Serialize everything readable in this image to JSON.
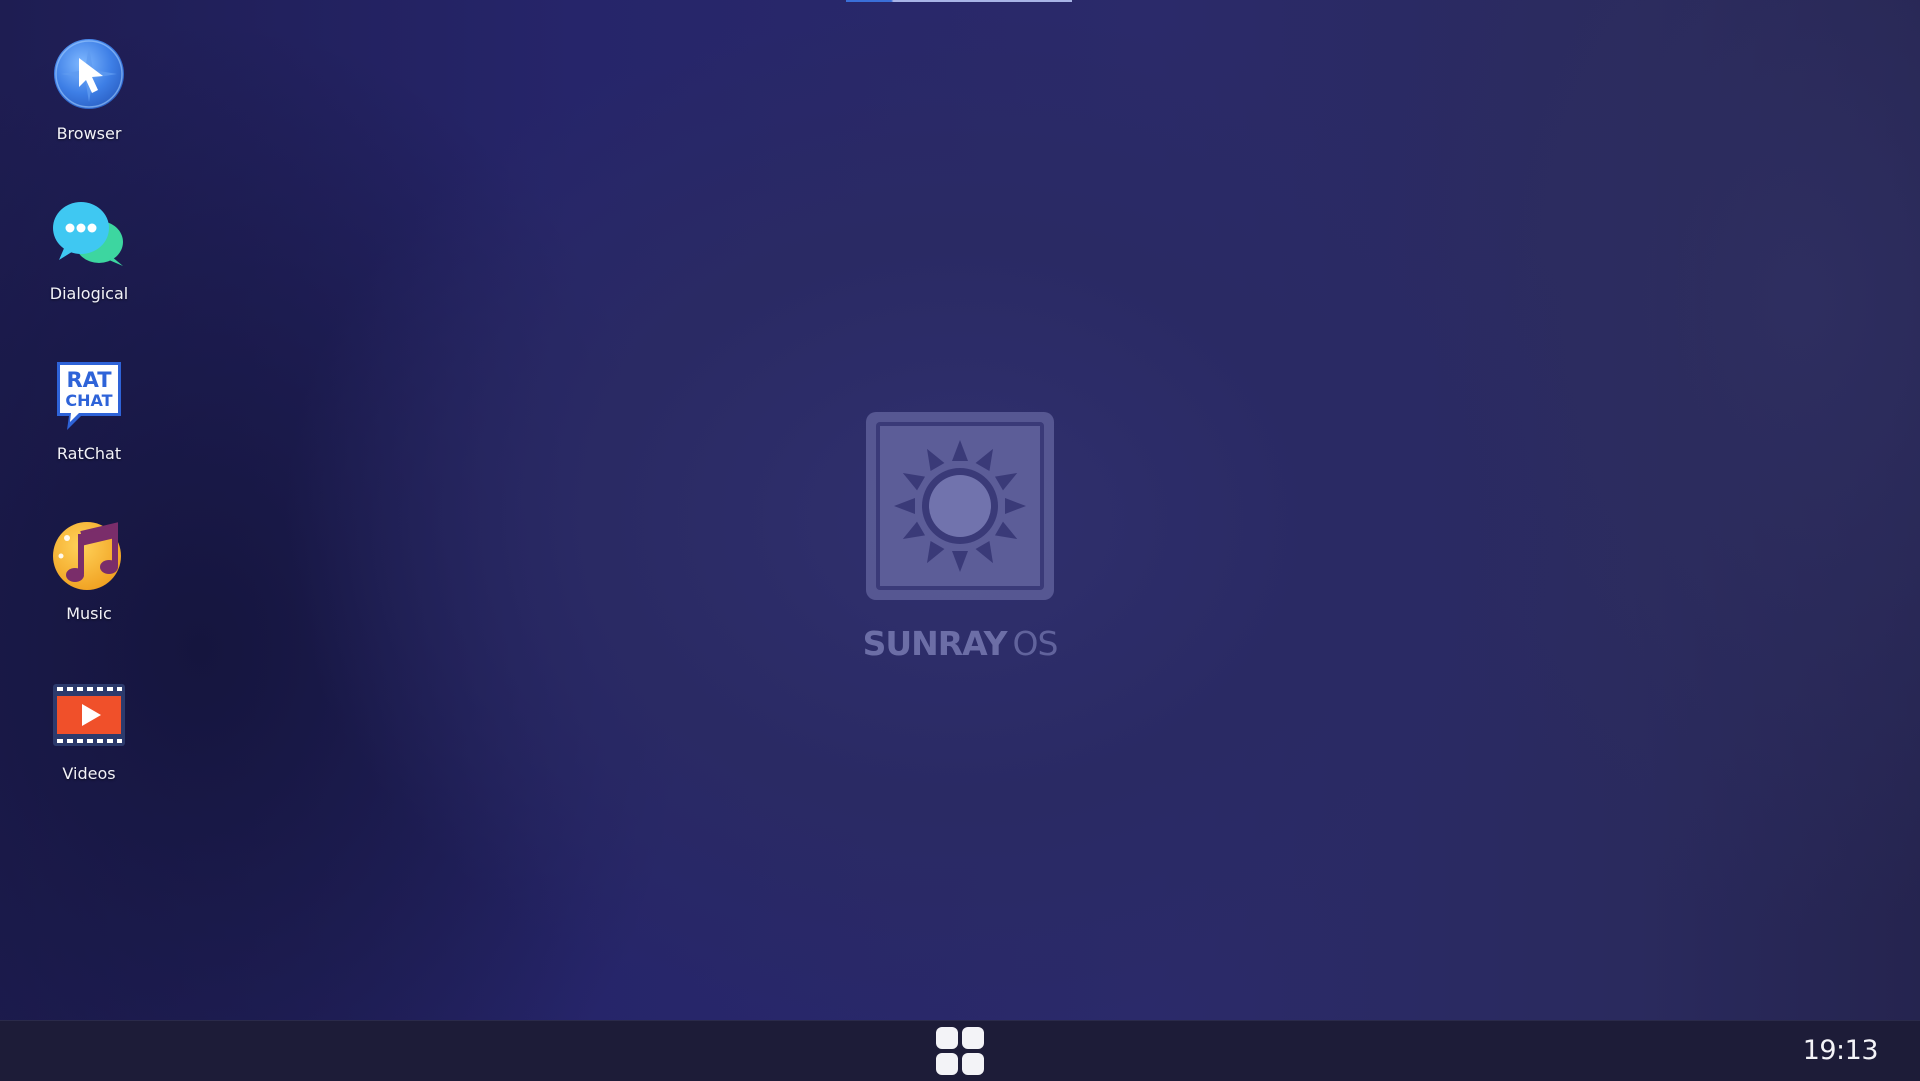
{
  "desktop": {
    "icons": [
      {
        "label": "Browser",
        "icon": "browser-compass-icon"
      },
      {
        "label": "Dialogical",
        "icon": "chat-bubbles-icon"
      },
      {
        "label": "RatChat",
        "icon": "ratchat-icon"
      },
      {
        "label": "Music",
        "icon": "music-note-icon"
      },
      {
        "label": "Videos",
        "icon": "video-film-icon"
      }
    ],
    "logo": {
      "bold_text": "SUNRAY",
      "light_text": "OS",
      "icon_text_top": "RAT",
      "icon_text_bottom": "CHAT"
    }
  },
  "taskbar": {
    "start_icon": "grid-four-icon",
    "clock": "19:13"
  },
  "colors": {
    "background": "#29285f",
    "taskbar": "#1d1c38",
    "logo": "#787ab2"
  }
}
